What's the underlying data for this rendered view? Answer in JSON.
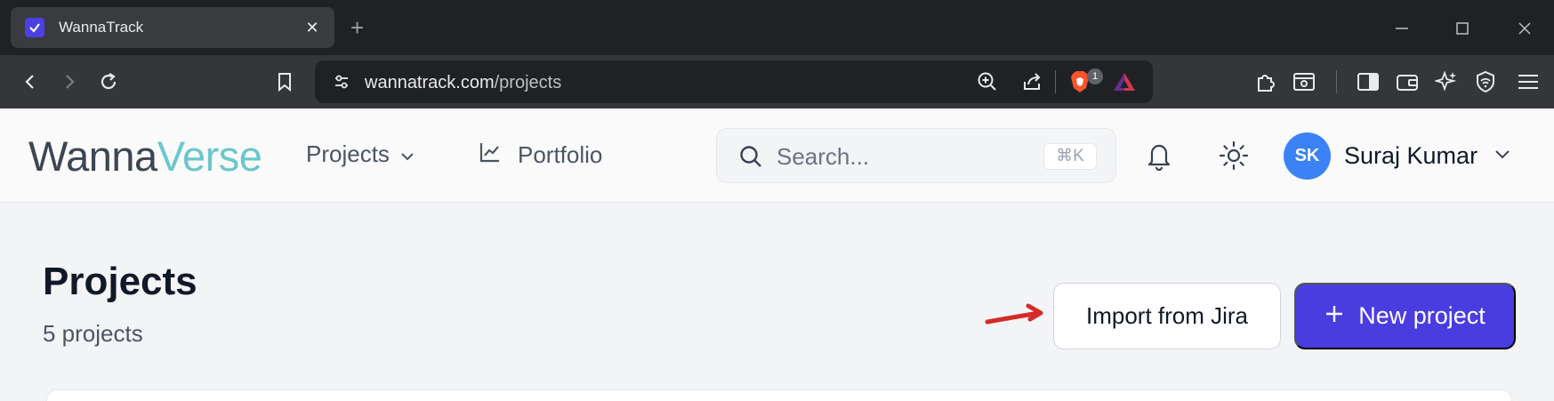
{
  "browser": {
    "tab_title": "WannaTrack",
    "new_tab": "+",
    "url_domain": "wannatrack.com",
    "url_path": "/projects",
    "shields_badge": "1"
  },
  "header": {
    "logo_part1": "Wanna",
    "logo_part2": "Verse",
    "nav_projects": "Projects",
    "nav_portfolio": "Portfolio",
    "search_placeholder": "Search...",
    "search_shortcut": "⌘K",
    "avatar_initials": "SK",
    "user_name": "Suraj Kumar"
  },
  "page": {
    "title": "Projects",
    "subtitle": "5 projects",
    "import_button": "Import from Jira",
    "new_button": "New project"
  },
  "colors": {
    "primary": "#4a3de0",
    "avatar": "#3b82f6",
    "logo_accent": "#6bc7cc",
    "annotation_arrow": "#d42a2a"
  }
}
